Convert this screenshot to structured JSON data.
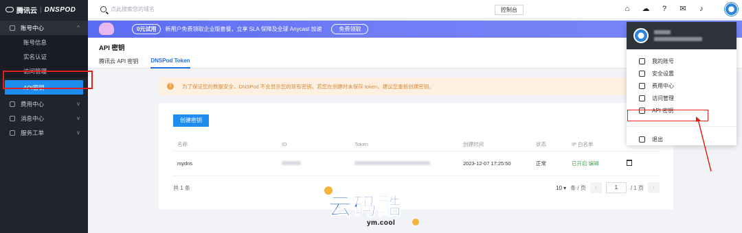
{
  "logo": {
    "brand": "腾讯云",
    "product": "DNSPOD"
  },
  "sidebar": {
    "items": [
      {
        "label": "账号中心",
        "chev": "^"
      },
      {
        "label": "账号信息"
      },
      {
        "label": "实名认证"
      },
      {
        "label": "访问管理"
      },
      {
        "label": "API密钥"
      },
      {
        "label": "费用中心",
        "chev": "v"
      },
      {
        "label": "消息中心",
        "chev": "v"
      },
      {
        "label": "服务工单",
        "chev": "v"
      }
    ]
  },
  "topbar": {
    "search_placeholder": "点此搜索您的域名",
    "console": "控制台"
  },
  "banner": {
    "pill": "0元试用",
    "text": "新用户免费领取企业版套餐，立享 SLA 保障及全球 Anycast 加速",
    "cta": "免费领取"
  },
  "page": {
    "title": "API 密钥",
    "tabs": [
      {
        "label": "腾讯云 API 密钥"
      },
      {
        "label": "DNSPod Token"
      }
    ]
  },
  "alert": {
    "icon": "!",
    "text": "为了保证您的数据安全，DNSPod 不会显示您的现有密钥，若您在创建时未保存 token，建议您重新创建密钥。"
  },
  "card": {
    "create_button": "创建密钥",
    "columns": [
      "名称",
      "ID",
      "Token",
      "创建时间",
      "状态",
      "IP 白名单"
    ],
    "rows": [
      {
        "name": "mydns",
        "created": "2023-12-07 17:25:50",
        "status": "正常",
        "whitelist": "已开启",
        "whitelist_link": "编辑"
      }
    ],
    "total": "共 1 条",
    "page_size": "10 ▾",
    "per_page": "条 / 页",
    "prev": "‹",
    "page_input": "1",
    "page_total": "/ 1 页",
    "next": "›"
  },
  "dropdown": {
    "items": [
      {
        "label": "我的账号",
        "icon": "user-icon"
      },
      {
        "label": "安全设置",
        "icon": "shield-icon"
      },
      {
        "label": "费用中心",
        "icon": "wallet-icon"
      },
      {
        "label": "访问管理",
        "icon": "access-icon"
      },
      {
        "label": "API 密钥",
        "icon": "key-shield-icon"
      }
    ],
    "logout": "退出"
  },
  "watermark": {
    "text": "云码酷",
    "sub": "ym.cool"
  },
  "colors": {
    "accent": "#1f8cf0",
    "highlight": "#e0201a",
    "sidebar": "#20242c"
  }
}
